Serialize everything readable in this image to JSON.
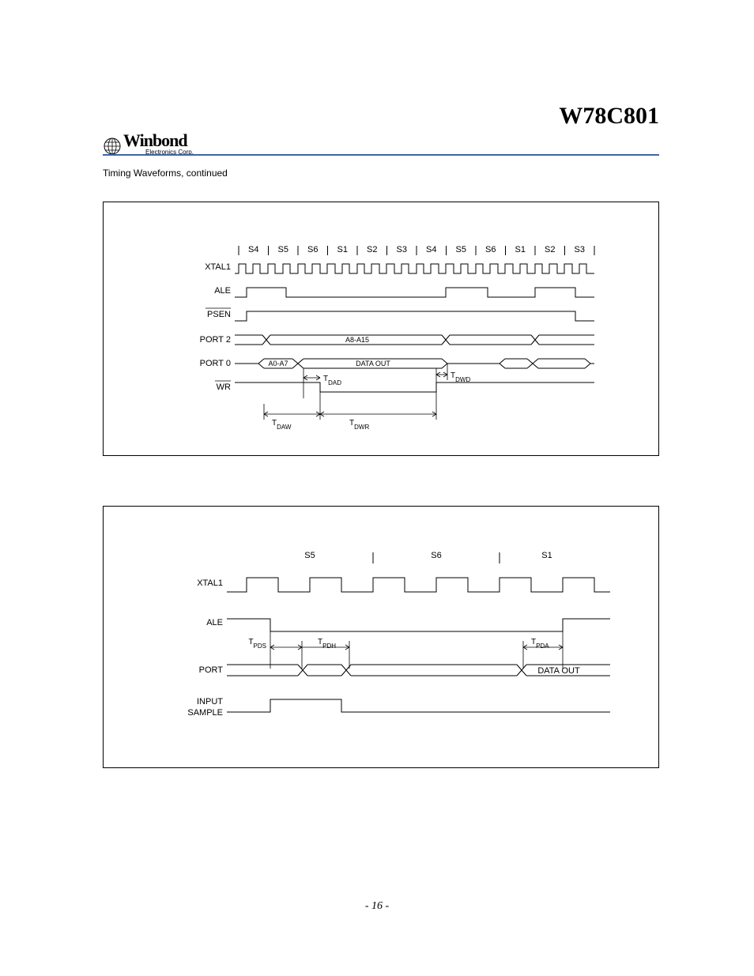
{
  "header": {
    "part_number": "W78C801",
    "logo_main": "Winbond",
    "logo_sub": "Electronics Corp."
  },
  "section_title": "Timing Waveforms, continued",
  "fig1": {
    "state_labels": [
      "S4",
      "S5",
      "S6",
      "S1",
      "S2",
      "S3",
      "S4",
      "S5",
      "S6",
      "S1",
      "S2",
      "S3"
    ],
    "signals": {
      "xtal1": "XTAL1",
      "ale": "ALE",
      "psen": "PSEN",
      "port2": "PORT 2",
      "port0": "PORT 0",
      "wr": "WR"
    },
    "bus_labels": {
      "a8a15": "A8-A15",
      "a0a7": "A0-A7",
      "data_out": "DATA OUT"
    },
    "timing": {
      "tdad": "DAD",
      "tdwd": "DWD",
      "tdaw": "DAW",
      "tdwr": "DWR"
    }
  },
  "fig2": {
    "state_labels": [
      "S5",
      "S6",
      "S1"
    ],
    "signals": {
      "xtal1": "XTAL1",
      "ale": "ALE",
      "port": "PORT",
      "input_sample_1": "INPUT",
      "input_sample_2": "SAMPLE"
    },
    "bus_labels": {
      "data_out": "DATA OUT"
    },
    "timing": {
      "tpds": "PDS",
      "tpdh": "PDH",
      "tpda": "PDA"
    }
  },
  "page_number": "- 16 -"
}
